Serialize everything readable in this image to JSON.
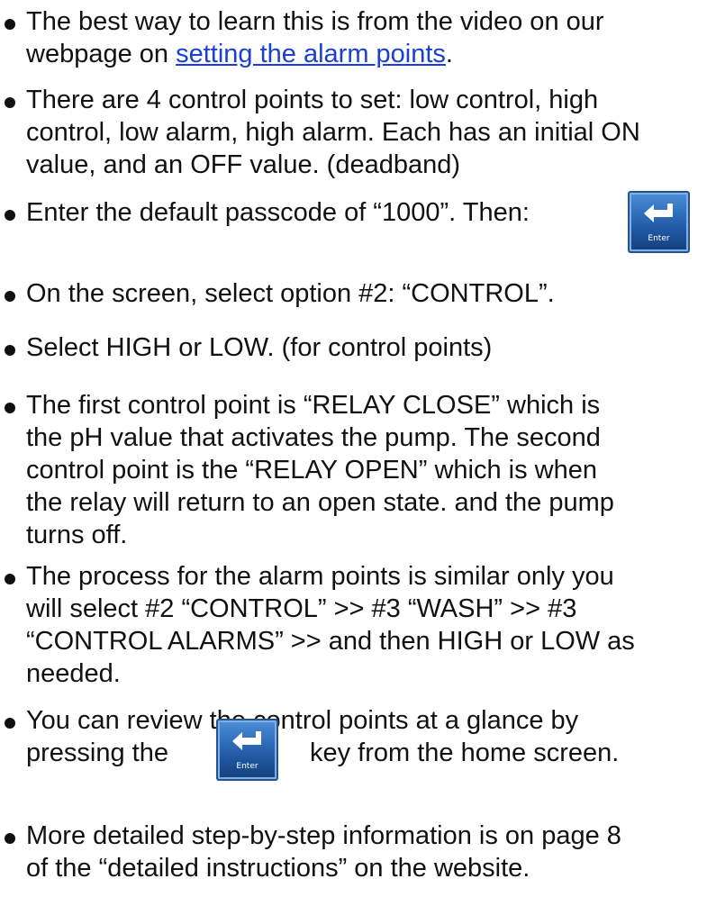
{
  "items": [
    {
      "lines": [
        "The best way to learn this is from the video on our"
      ],
      "link_prefix": "webpage on ",
      "link_text": "setting the alarm points",
      "link_suffix": "."
    },
    {
      "lines": [
        "There are 4 control points to set: low control, high",
        "control, low alarm, high alarm. Each has an initial ON",
        "value, and an OFF value. (deadband)"
      ]
    },
    {
      "lines": [
        "Enter the default passcode of “1000”.  Then:"
      ]
    },
    {
      "lines": [
        "On the screen, select option #2: “CONTROL”."
      ]
    },
    {
      "lines": [
        "Select HIGH or LOW. (for control points)"
      ]
    },
    {
      "lines": [
        "The first control point is “RELAY CLOSE” which is",
        "the pH value that activates the pump. The second",
        "control  point is the “RELAY OPEN” which is when",
        "the relay will return to an open state. and the pump",
        "turns off."
      ]
    },
    {
      "lines": [
        "The process for the alarm points is similar only you",
        "will select #2 “CONTROL” >> #3 “WASH” >> #3",
        "“CONTROL ALARMS” >> and then HIGH or LOW as",
        "needed."
      ]
    },
    {
      "lines": [
        "You can review the control points at a glance by"
      ],
      "before_key": "pressing the",
      "after_key": "key from the home screen."
    },
    {
      "lines": [
        "More detailed step-by-step information is on page 8",
        "of the “detailed instructions” on the website."
      ]
    }
  ],
  "enter_key": {
    "label": "Enter",
    "icon": "enter-return-arrow-icon",
    "color": "#2f6fbd"
  }
}
